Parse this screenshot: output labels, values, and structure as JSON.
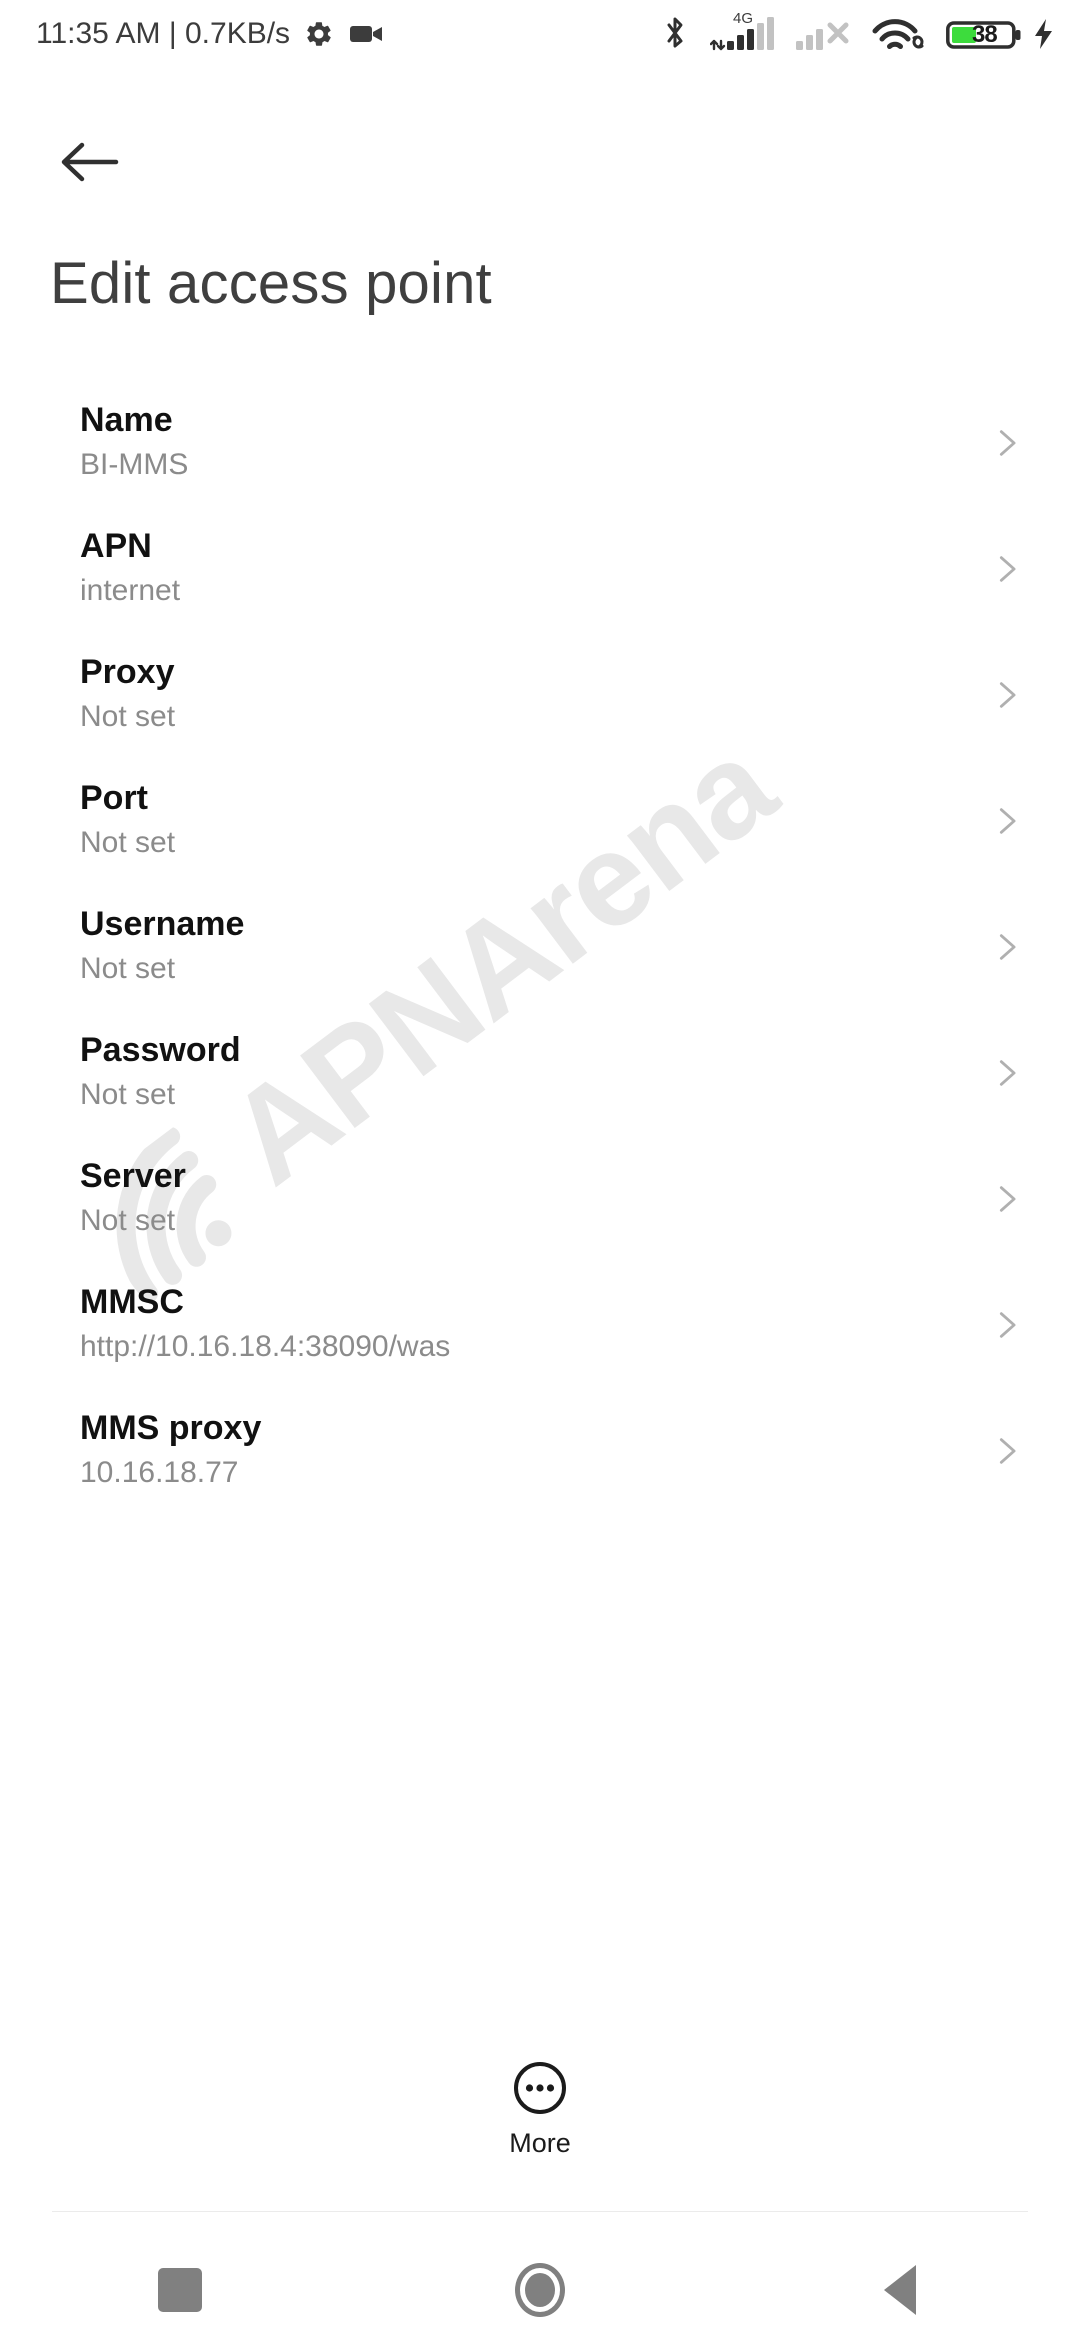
{
  "statusbar": {
    "time_and_rate": "11:35 AM | 0.7KB/s",
    "gear_icon": "gear-icon",
    "camera_icon": "video-camera-icon",
    "bluetooth_icon": "bluetooth-icon",
    "network_type": "4G",
    "sim1_icon": "signal-bars-sim1-icon",
    "sim2_icon": "signal-bars-sim2-no-service-icon",
    "wifi_icon": "wifi-with-link-icon",
    "battery_level": "38",
    "battery_icon": "battery-icon",
    "charging_icon": "charging-bolt-icon",
    "battery_fill_color": "#3ddc3d"
  },
  "header": {
    "back_icon": "arrow-left-icon",
    "title": "Edit access point"
  },
  "watermark": {
    "text": "APNArena",
    "color": "#e8e8e8"
  },
  "list": {
    "chevron_icon": "chevron-right-icon",
    "rows": [
      {
        "title": "Name",
        "value": "BI-MMS"
      },
      {
        "title": "APN",
        "value": "internet"
      },
      {
        "title": "Proxy",
        "value": "Not set"
      },
      {
        "title": "Port",
        "value": "Not set"
      },
      {
        "title": "Username",
        "value": "Not set"
      },
      {
        "title": "Password",
        "value": "Not set"
      },
      {
        "title": "Server",
        "value": "Not set"
      },
      {
        "title": "MMSC",
        "value": "http://10.16.18.4:38090/was"
      },
      {
        "title": "MMS proxy",
        "value": "10.16.18.77"
      }
    ]
  },
  "more": {
    "label": "More",
    "icon": "more-horizontal-circle-icon"
  },
  "navbar": {
    "recents_icon": "square-recents-icon",
    "home_icon": "circle-home-icon",
    "back_icon": "triangle-back-icon",
    "color": "#808080"
  }
}
